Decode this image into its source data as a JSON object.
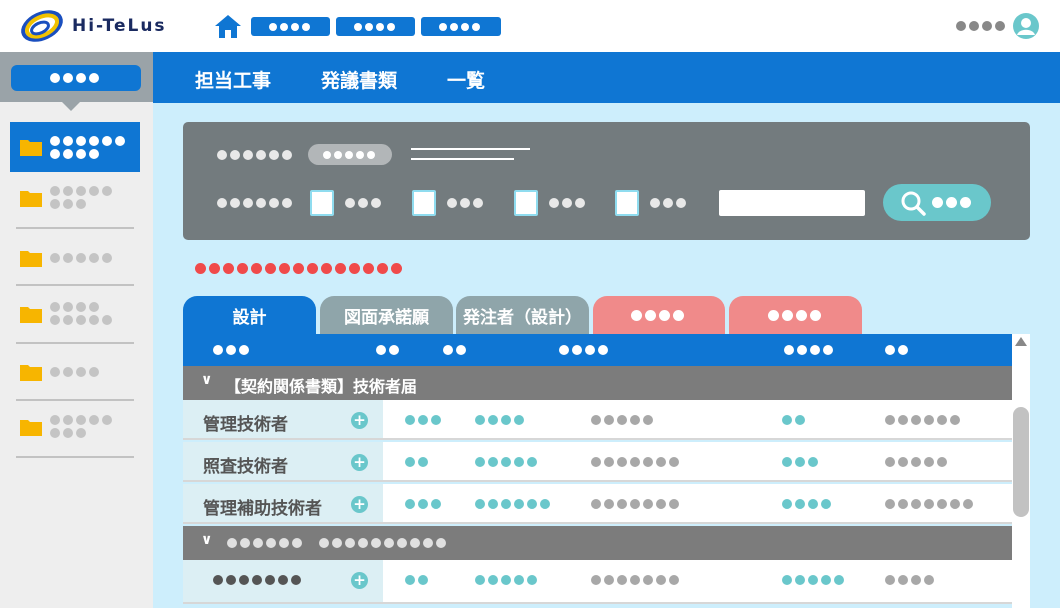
{
  "app": {
    "logo_text": "Hi-TeLus"
  },
  "header": {
    "nav_count": 3,
    "user_dots": 4
  },
  "topnav": {
    "items": [
      "担当工事",
      "発議書類",
      "一覧"
    ]
  },
  "colors": {
    "primary": "#0f76d3",
    "teal": "#6ac7cb",
    "red": "#f04a4a",
    "tab_gray": "#8fa5aa",
    "tab_red": "#f08a8a"
  },
  "icons": {
    "home": "home-icon",
    "user": "user-avatar-icon",
    "folder": "folder-icon",
    "search": "search-icon",
    "plus": "plus-icon",
    "chevron": "chevron-down-icon"
  },
  "tabs": [
    {
      "label": "設計",
      "active": true
    },
    {
      "label": "図面承諾願",
      "active": false
    },
    {
      "label": "発注者（設計）",
      "active": false
    },
    {
      "label": "",
      "placeholder": true
    },
    {
      "label": "",
      "placeholder": true
    }
  ],
  "table": {
    "group1_label": "【契約関係書類】技術者届",
    "group1_chevron": "∨",
    "rows": [
      {
        "label": "管理技術者"
      },
      {
        "label": "照査技術者"
      },
      {
        "label": "管理補助技術者"
      }
    ],
    "group2_chevron": "∨",
    "plus": "+"
  }
}
